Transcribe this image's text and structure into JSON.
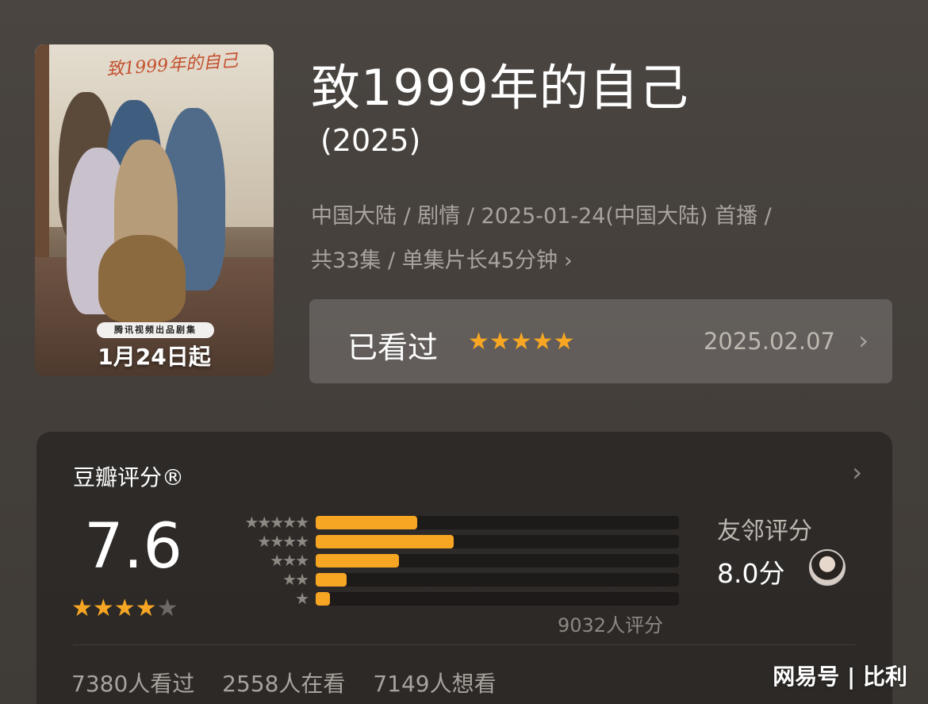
{
  "poster": {
    "scribble": "致1999年的自己",
    "badge": "腾讯视频出品剧集",
    "release": "1月24日起"
  },
  "title": "致1999年的自己",
  "year": "(2025)",
  "meta": {
    "line1": "中国大陆 / 剧情 / 2025-01-24(中国大陆) 首播 /",
    "line2": "共33集 / 单集片长45分钟"
  },
  "watched": {
    "label": "已看过",
    "stars": "★★★★★",
    "date": "2025.02.07"
  },
  "rating": {
    "header": "豆瓣评分®",
    "score": "7.6",
    "stars_on": "★★★★",
    "stars_off": "★",
    "breakdown": [
      {
        "stars": "★★★★★",
        "fraction": 0.28
      },
      {
        "stars": "★★★★",
        "fraction": 0.38
      },
      {
        "stars": "★★★",
        "fraction": 0.23
      },
      {
        "stars": "★★",
        "fraction": 0.085
      },
      {
        "stars": "★",
        "fraction": 0.04
      }
    ],
    "count": "9032人评分",
    "neighbor_label": "友邻评分",
    "neighbor_score": "8.0分"
  },
  "stats": {
    "seen": "7380人看过",
    "watching": "2558人在看",
    "want": "7149人想看"
  },
  "watermark": "网易号 | 比利",
  "colors": {
    "accent": "#f6a623"
  }
}
